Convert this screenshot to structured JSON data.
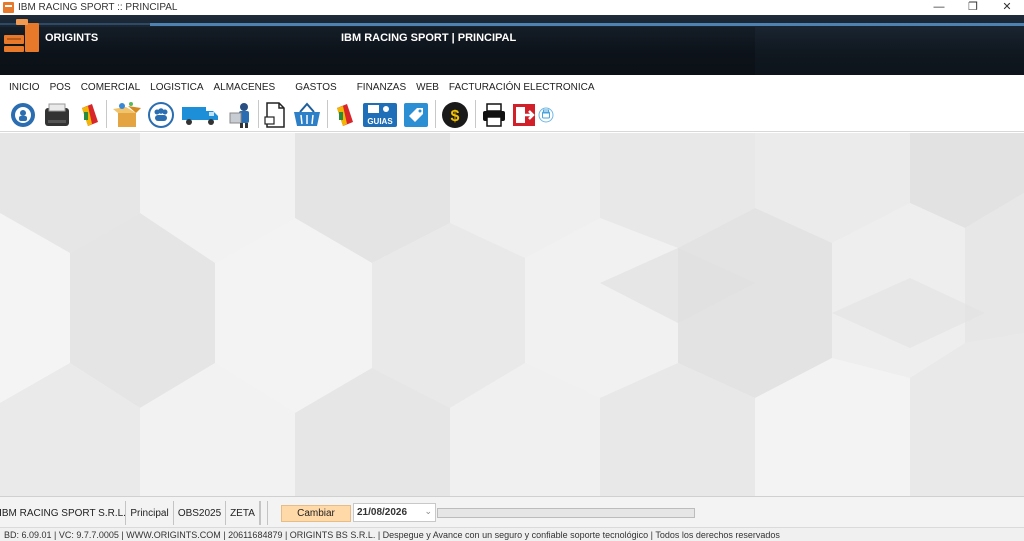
{
  "window": {
    "title": "IBM RACING SPORT :: PRINCIPAL",
    "controls": [
      "—",
      "❐",
      "✕"
    ]
  },
  "header": {
    "brand": "ORIGINTS",
    "title": "IBM RACING SPORT | PRINCIPAL"
  },
  "menu": {
    "items": [
      "INICIO",
      "POS",
      "COMERCIAL",
      "LOGISTICA",
      "ALMACENES",
      "GASTOS",
      "FINANZAS",
      "WEB",
      "FACTURACIÓN ELECTRONICA"
    ]
  },
  "toolbar": {
    "icons": [
      "support-icon",
      "receipt-printer-icon",
      "price-tag-icon",
      "open-box-icon",
      "people-icon",
      "delivery-truck-icon",
      "delivery-person-icon",
      "document-icon",
      "shopping-basket-icon",
      "price-tag-2-icon",
      "guias-icon",
      "tag-icon",
      "dollar-coin-icon",
      "printer-icon",
      "exit-door-icon",
      "print-small-icon"
    ],
    "guias_label": "GUIAS"
  },
  "status": {
    "company": "IBM RACING SPORT S.R.L.",
    "branch": "Principal",
    "database": "OBS2025",
    "user": "ZETA",
    "change_button": "Cambiar",
    "date": "21/08/2026"
  },
  "footer": {
    "text": "BD: 6.09.01 | VC: 9.7.7.0005 | WWW.ORIGINTS.COM | 20611684879 | ORIGINTS BS S.R.L. | Despegue y Avance con un seguro y confiable soporte tecnológico | Todos los derechos reservados"
  },
  "colors": {
    "header_bg": "#101820",
    "header_accent": "#4e82b2",
    "brand_orange": "#e8782a",
    "change_button_bg": "#ffd9a8"
  }
}
